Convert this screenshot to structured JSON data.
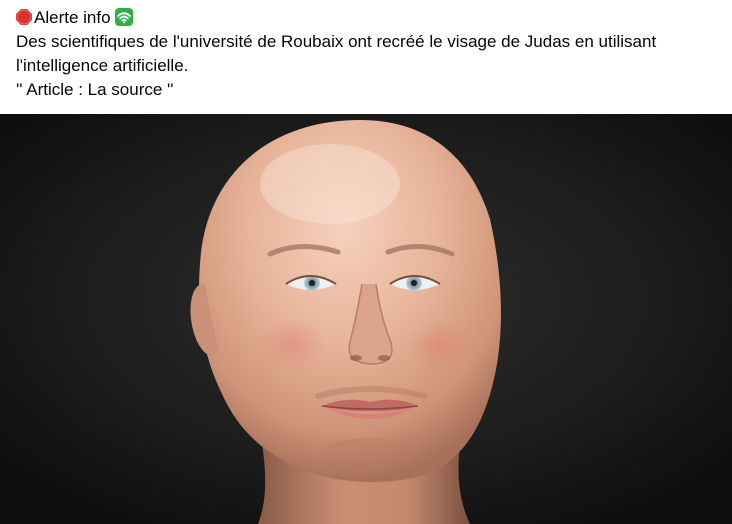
{
  "post": {
    "line1": "Alerte info",
    "line2": "Des scientifiques de l'université de Roubaix ont recréé le visage de Judas en utilisant",
    "line3": "l'intelligence artificielle.",
    "line4": "'' Article : La source ''",
    "icons": {
      "lead": "stop-sign-icon",
      "trail": "wifi-icon"
    }
  },
  "media": {
    "subject": "bald-male-head-render"
  },
  "colors": {
    "stop_red": "#d9342b",
    "wifi_green": "#31b049",
    "background_dark": "#1b1b1b",
    "skin": "#e7b9a0"
  }
}
